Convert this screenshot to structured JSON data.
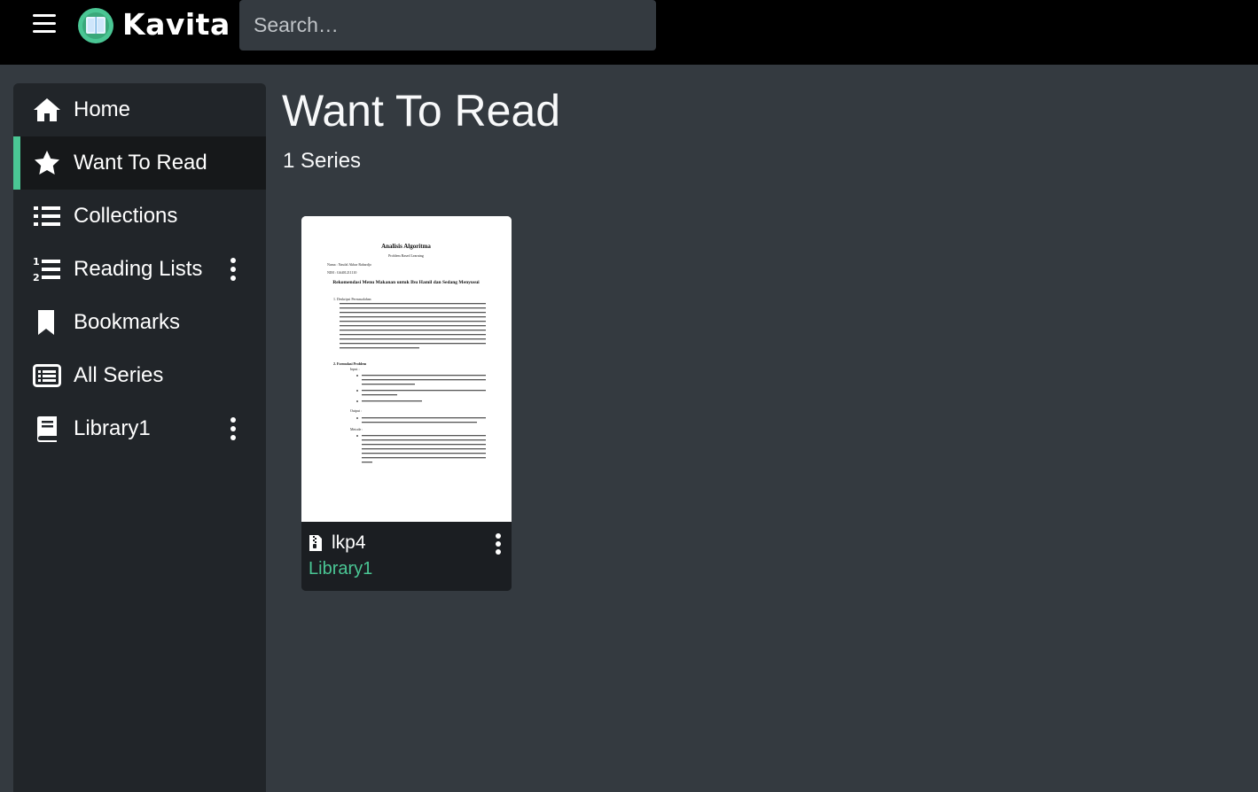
{
  "app": {
    "brand": "Kavita",
    "accent": "#4ac694",
    "icons": {
      "menu": "hamburger-icon",
      "logo": "book-logo-icon"
    }
  },
  "search": {
    "placeholder": "Search…"
  },
  "sidebar": {
    "items": [
      {
        "label": "Home",
        "icon": "home-icon",
        "active": false,
        "has_menu": false
      },
      {
        "label": "Want To Read",
        "icon": "star-icon",
        "active": true,
        "has_menu": false
      },
      {
        "label": "Collections",
        "icon": "list-icon",
        "active": false,
        "has_menu": false
      },
      {
        "label": "Reading Lists",
        "icon": "ordered-list-icon",
        "active": false,
        "has_menu": true
      },
      {
        "label": "Bookmarks",
        "icon": "bookmark-icon",
        "active": false,
        "has_menu": false
      },
      {
        "label": "All Series",
        "icon": "rectangle-list-icon",
        "active": false,
        "has_menu": false
      },
      {
        "label": "Library1",
        "icon": "book-icon",
        "active": false,
        "has_menu": true
      }
    ]
  },
  "main": {
    "title": "Want To Read",
    "subtitle": "1 Series",
    "cards": [
      {
        "title": "lkp4",
        "library": "Library1",
        "format_icon": "file-zip-icon",
        "cover": {
          "heading": "Analisis Algoritma",
          "sub": "Problem Based Learning",
          "name_line": "Nama : Naufal Akbar Rahardjo",
          "nim_line": "NIM : G6401211110",
          "doc_title": "Rekomendasi Menu Makanan untuk Ibu Hamil dan Sedang Menyusui",
          "section1": "1. Deskripsi Permasalahan",
          "section2": "2. Formulasi Problem",
          "input_label": "Input :",
          "output_label": "Output :",
          "method_label": "Metode :"
        }
      }
    ]
  }
}
